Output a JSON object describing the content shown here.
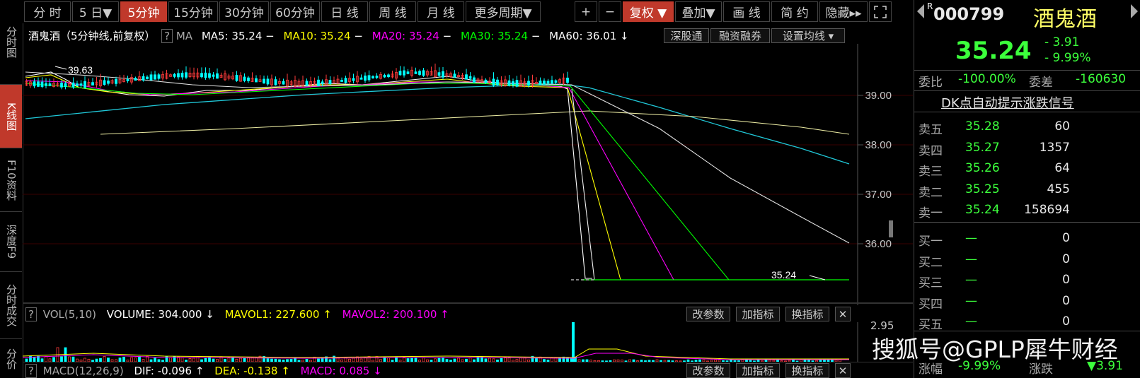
{
  "leftnav": [
    {
      "label": "分时图",
      "active": false
    },
    {
      "label": "K线图",
      "active": true
    },
    {
      "label": "F10资料",
      "active": false
    },
    {
      "label": "深度F9",
      "active": false
    },
    {
      "label": "分时成交",
      "active": false
    },
    {
      "label": "分价",
      "active": false
    }
  ],
  "toolbar": {
    "periods": [
      "分 时",
      "5 日▼",
      "5分钟",
      "15分钟",
      "30分钟",
      "60分钟",
      "日 线",
      "周 线",
      "月 线",
      "更多周期▼"
    ],
    "active_period": "5分钟",
    "plus": "+",
    "minus": "−",
    "fuquan": "复权 ▼",
    "diejia": "叠加▼",
    "huaxian": "画 线",
    "jianyue": "简 约",
    "yincang": "隐藏▸▸",
    "fullscreen_icon": "fullscreen-icon"
  },
  "main": {
    "title": "酒鬼酒（5分钟线,前复权）",
    "help": "?",
    "ma_label": "MA",
    "ma": [
      {
        "name": "MA5",
        "value": "35.24",
        "color": "#ffffff",
        "arrow": "−"
      },
      {
        "name": "MA10",
        "value": "35.24",
        "color": "#ffff00",
        "arrow": "−"
      },
      {
        "name": "MA20",
        "value": "35.24",
        "color": "#ff00ff",
        "arrow": "−"
      },
      {
        "name": "MA30",
        "value": "35.24",
        "color": "#00ff00",
        "arrow": "−"
      },
      {
        "name": "MA60",
        "value": "36.01",
        "color": "#ffffff",
        "arrow": "↓"
      }
    ],
    "buttons": [
      "深股通",
      "融资融券",
      "设置均线 ▾"
    ],
    "high_label": "39.63",
    "low_label": "35.24",
    "yaxis": [
      "39.00",
      "38.00",
      "37.00",
      "36.00"
    ]
  },
  "vol": {
    "help": "?",
    "name": "VOL(5,10)",
    "volume": "VOLUME: 304.000",
    "volume_arrow": "↓",
    "mavol1": "MAVOL1: 227.600",
    "mavol1_arrow": "↑",
    "mavol2": "MAVOL2: 200.100",
    "mavol2_arrow": "↑",
    "buttons": [
      "改参数",
      "加指标",
      "换指标",
      "✕"
    ],
    "yaxis": "2.95"
  },
  "macd": {
    "help": "?",
    "name": "MACD(12,26,9)",
    "dif": "DIF: -0.096",
    "dif_arrow": "↑",
    "dea": "DEA: -0.138",
    "dea_arrow": "↑",
    "macd": "MACD: 0.085",
    "macd_arrow": "↓",
    "buttons": [
      "改参数",
      "加指标",
      "换指标",
      "✕"
    ]
  },
  "right": {
    "r_mark": "R",
    "code": "000799",
    "name": "酒鬼酒",
    "price": "35.24",
    "change": "- 3.91",
    "change_pct": "- 9.99%",
    "weibi_label": "委比",
    "weibi": "-100.00%",
    "weicha_label": "委差",
    "weicha": "-160630",
    "signal": "DK点自动提示涨跌信号",
    "sells": [
      {
        "label": "卖五",
        "price": "35.28",
        "vol": "60"
      },
      {
        "label": "卖四",
        "price": "35.27",
        "vol": "1357"
      },
      {
        "label": "卖三",
        "price": "35.26",
        "vol": "64"
      },
      {
        "label": "卖二",
        "price": "35.25",
        "vol": "455"
      },
      {
        "label": "卖一",
        "price": "35.24",
        "vol": "158694"
      }
    ],
    "buys": [
      {
        "label": "买一",
        "price": "—",
        "vol": "0"
      },
      {
        "label": "买二",
        "price": "—",
        "vol": "0"
      },
      {
        "label": "买三",
        "price": "—",
        "vol": "0"
      },
      {
        "label": "买四",
        "price": "—",
        "vol": "0"
      },
      {
        "label": "买五",
        "price": "—",
        "vol": "0"
      }
    ],
    "bottom_label1": "涨幅",
    "bottom_val1": "-9.99%",
    "bottom_label2": "涨跌",
    "bottom_val2": "▼3.91"
  },
  "watermark": "搜狐号@GPLP犀牛财经",
  "colors": {
    "up": "#ff3b3b",
    "down": "#00ffff",
    "green": "#3cff3c",
    "active": "#c0392b"
  }
}
